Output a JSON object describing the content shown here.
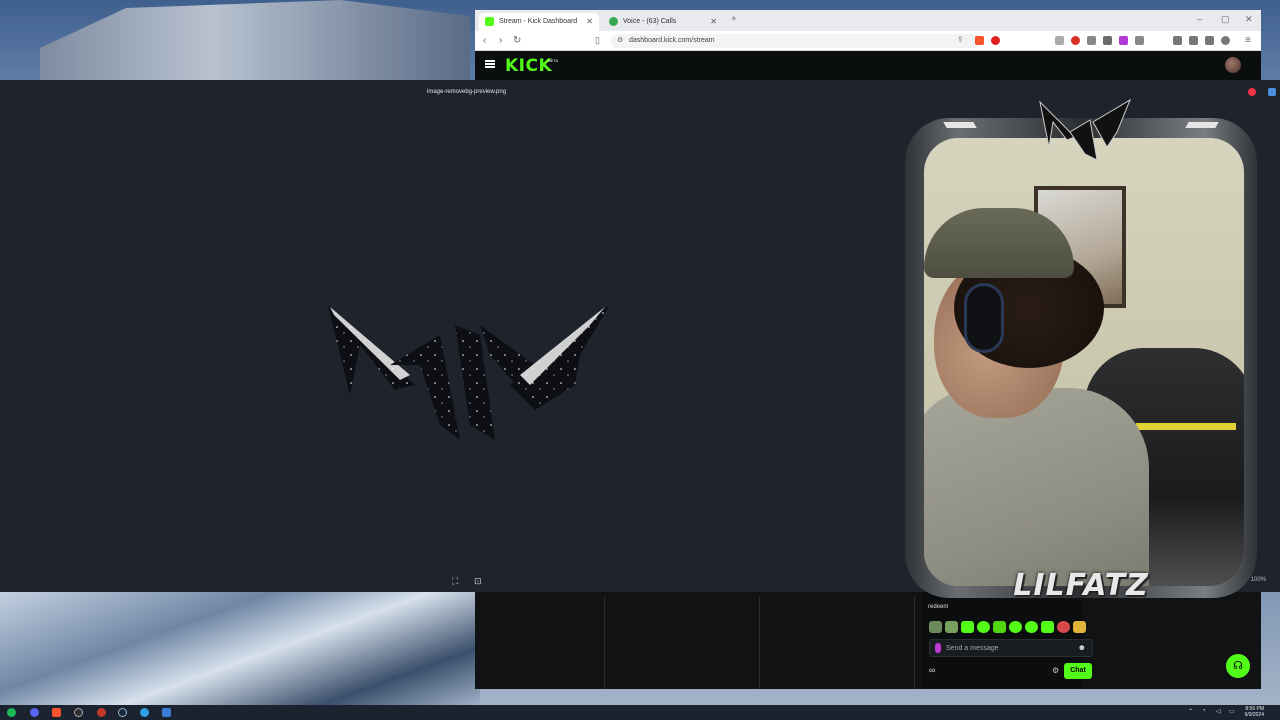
{
  "browser": {
    "tabs": [
      {
        "label": "Stream - Kick Dashboard",
        "active": true,
        "favicon_color": "#53fc18"
      },
      {
        "label": "Voice - (63) Calls",
        "active": false,
        "favicon_color": "#34a853"
      }
    ],
    "url": "dashboard.kick.com/stream",
    "new_tab_symbol": "+"
  },
  "kick": {
    "logo": "KICK",
    "badge": "BETA"
  },
  "preview": {
    "filename": "image-removebg-preview.png",
    "zoom": "100%"
  },
  "chat": {
    "redeem_label": "redeem",
    "message_placeholder": "Send a message",
    "chat_button": "Chat",
    "accent_color": "#53fc18"
  },
  "webcam": {
    "streamer_name": "LILFATZ"
  },
  "taskbar": {
    "time": "8:56 PM",
    "date": "9/9/2024"
  }
}
